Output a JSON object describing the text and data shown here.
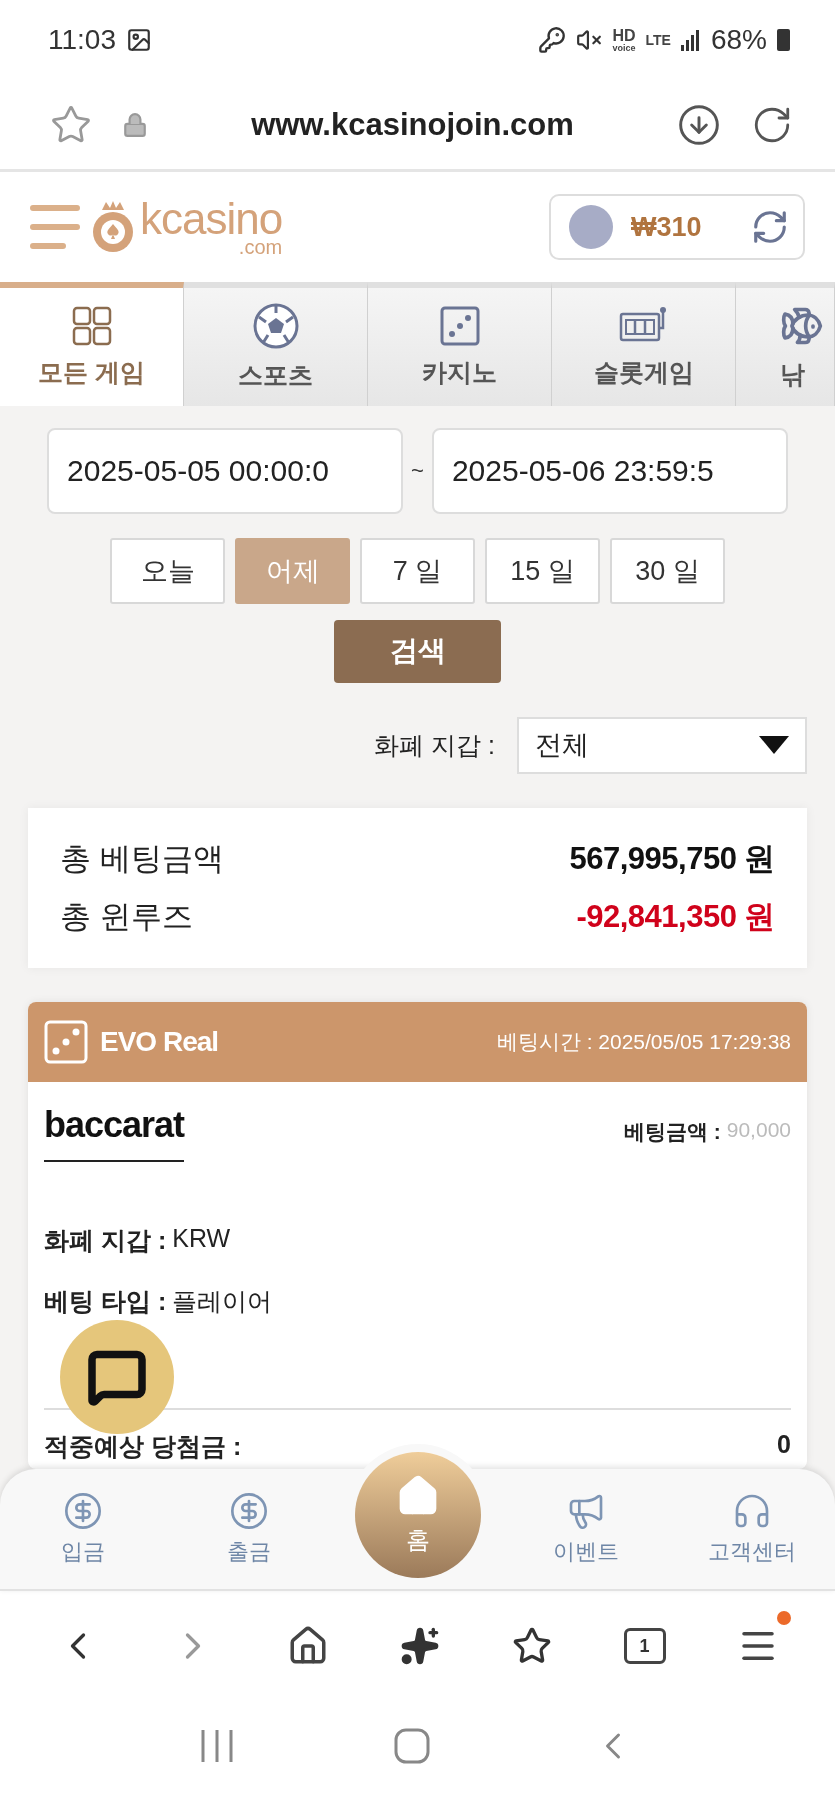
{
  "status_bar": {
    "time": "11:03",
    "hd": "HD",
    "voice": "voice",
    "network": "LTE",
    "battery": "68%"
  },
  "browser": {
    "url": "www.kcasinojoin.com"
  },
  "site_header": {
    "logo": "kcasino",
    "logo_suffix": ".com",
    "balance": "₩310"
  },
  "tabs": [
    {
      "label": "모든 게임",
      "kind": "grid",
      "selected": true
    },
    {
      "label": "스포츠",
      "kind": "ball",
      "selected": false
    },
    {
      "label": "카지노",
      "kind": "dice",
      "selected": false
    },
    {
      "label": "슬롯게임",
      "kind": "slot",
      "selected": false
    },
    {
      "label": "낚",
      "kind": "fish",
      "selected": false
    }
  ],
  "date_range": {
    "from": "2025-05-05 00:00:0",
    "separator": "~",
    "to": "2025-05-06 23:59:5"
  },
  "periods": [
    {
      "label": "오늘",
      "selected": false
    },
    {
      "label": "어제",
      "selected": true
    },
    {
      "label": "7 일",
      "selected": false
    },
    {
      "label": "15 일",
      "selected": false
    },
    {
      "label": "30 일",
      "selected": false
    }
  ],
  "search_button": "검색",
  "wallet_filter": {
    "label": "화폐 지갑 :",
    "value": "전체"
  },
  "summary": [
    {
      "label": "총 베팅금액",
      "value": "567,995,750 원",
      "color": "#111111"
    },
    {
      "label": "총 윈루즈",
      "value": "-92,841,350 원",
      "color": "#d0021b"
    }
  ],
  "bet": {
    "provider": "EVO Real",
    "time_label": "베팅시간 :",
    "time": "2025/05/05 17:29:38",
    "game": "baccarat",
    "amount_label": "베팅금액 :",
    "amount": "90,000",
    "details": [
      {
        "label": "화폐 지갑 :",
        "value": "KRW"
      },
      {
        "label": "베팅 타입 :",
        "value": "플레이어"
      }
    ],
    "payout_label": "적중예상 당첨금 :",
    "payout": "0"
  },
  "bottom_nav": [
    {
      "label": "입금",
      "kind": "deposit",
      "selected": false
    },
    {
      "label": "출금",
      "kind": "withdraw",
      "selected": false
    },
    {
      "label": "홈",
      "kind": "home",
      "selected": true
    },
    {
      "label": "이벤트",
      "kind": "event",
      "selected": false
    },
    {
      "label": "고객센터",
      "kind": "support",
      "selected": false
    }
  ],
  "browser_toolbar": {
    "tab_count": "1",
    "menu_badge": true
  }
}
